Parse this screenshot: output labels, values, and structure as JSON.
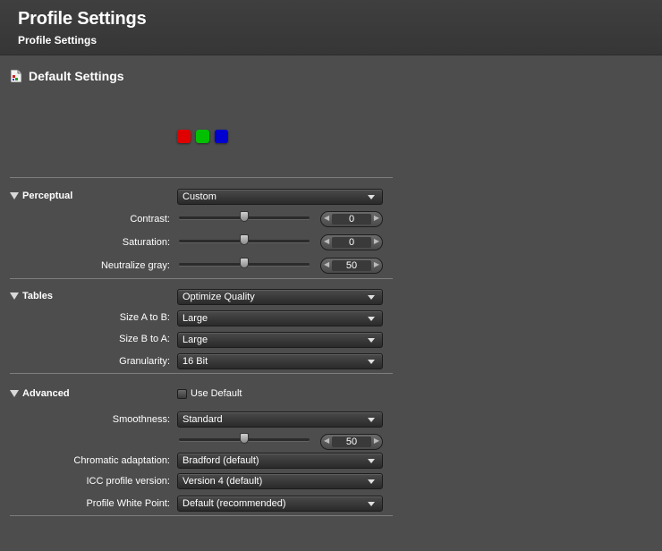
{
  "header": {
    "title": "Profile Settings",
    "subtitle": "Profile Settings"
  },
  "section": {
    "title": "Default Settings",
    "icon": "document-icon"
  },
  "swatches": {
    "red": "#e00000",
    "green": "#00c000",
    "blue": "#0000d0"
  },
  "perceptual": {
    "label": "Perceptual",
    "mode": "Custom",
    "contrast": {
      "label": "Contrast:",
      "value": "0",
      "level": 0.5
    },
    "saturation": {
      "label": "Saturation:",
      "value": "0",
      "level": 0.5
    },
    "neutralize": {
      "label": "Neutralize gray:",
      "value": "50",
      "level": 0.5
    }
  },
  "tables": {
    "label": "Tables",
    "mode": "Optimize Quality",
    "size_ab": {
      "label": "Size A to B:",
      "value": "Large"
    },
    "size_ba": {
      "label": "Size B to A:",
      "value": "Large"
    },
    "granularity": {
      "label": "Granularity:",
      "value": "16 Bit"
    }
  },
  "advanced": {
    "label": "Advanced",
    "use_default": {
      "label": "Use Default",
      "checked": false
    },
    "smoothness": {
      "label": "Smoothness:",
      "value": "Standard",
      "slider_value": "50",
      "level": 0.5
    },
    "chromatic": {
      "label": "Chromatic adaptation:",
      "value": "Bradford (default)"
    },
    "icc": {
      "label": "ICC profile version:",
      "value": "Version 4 (default)"
    },
    "white_point": {
      "label": "Profile White Point:",
      "value": "Default (recommended)"
    }
  }
}
